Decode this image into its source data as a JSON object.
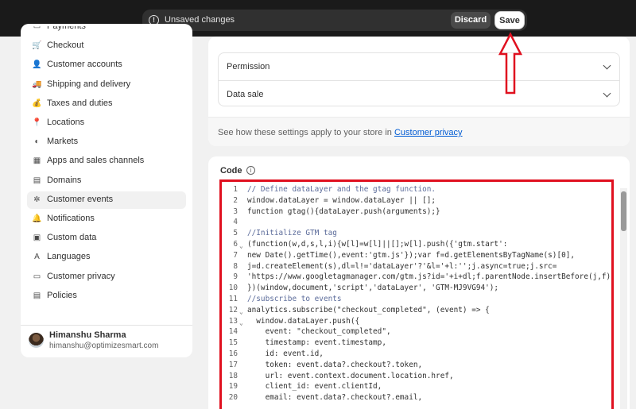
{
  "savebar": {
    "message": "Unsaved changes",
    "discard_label": "Discard",
    "save_label": "Save"
  },
  "sidebar": {
    "items": [
      {
        "label": "Payments",
        "icon": "payments-icon"
      },
      {
        "label": "Checkout",
        "icon": "cart-icon"
      },
      {
        "label": "Customer accounts",
        "icon": "person-icon"
      },
      {
        "label": "Shipping and delivery",
        "icon": "truck-icon"
      },
      {
        "label": "Taxes and duties",
        "icon": "tax-icon"
      },
      {
        "label": "Locations",
        "icon": "location-pin-icon"
      },
      {
        "label": "Markets",
        "icon": "globe-icon"
      },
      {
        "label": "Apps and sales channels",
        "icon": "apps-icon"
      },
      {
        "label": "Domains",
        "icon": "domains-icon"
      },
      {
        "label": "Customer events",
        "icon": "customer-events-icon",
        "active": true
      },
      {
        "label": "Notifications",
        "icon": "bell-icon"
      },
      {
        "label": "Custom data",
        "icon": "custom-data-icon"
      },
      {
        "label": "Languages",
        "icon": "languages-icon"
      },
      {
        "label": "Customer privacy",
        "icon": "privacy-icon"
      },
      {
        "label": "Policies",
        "icon": "policies-icon"
      }
    ],
    "user": {
      "name": "Himanshu Sharma",
      "email": "himanshu@optimizesmart.com"
    }
  },
  "settings": {
    "accordion": [
      "Permission",
      "Data sale"
    ],
    "privacy_note": "See how these settings apply to your store in ",
    "privacy_link": "Customer privacy"
  },
  "code_section": {
    "title": "Code",
    "lines": [
      {
        "n": "1",
        "fold": false,
        "text": "// Define dataLayer and the gtag function."
      },
      {
        "n": "2",
        "fold": false,
        "text": "window.dataLayer = window.dataLayer || [];"
      },
      {
        "n": "3",
        "fold": false,
        "text": "function gtag(){dataLayer.push(arguments);}"
      },
      {
        "n": "4",
        "fold": false,
        "text": ""
      },
      {
        "n": "5",
        "fold": false,
        "text": "//Initialize GTM tag"
      },
      {
        "n": "6",
        "fold": true,
        "text": "(function(w,d,s,l,i){w[l]=w[l]||[];w[l].push({'gtm.start':"
      },
      {
        "n": "7",
        "fold": false,
        "text": "new Date().getTime(),event:'gtm.js'});var f=d.getElementsByTagName(s)[0],"
      },
      {
        "n": "8",
        "fold": false,
        "text": "j=d.createElement(s),dl=l!='dataLayer'?'&l='+l:'';j.async=true;j.src="
      },
      {
        "n": "9",
        "fold": false,
        "text": "'https://www.googletagmanager.com/gtm.js?id='+i+dl;f.parentNode.insertBefore(j,f);"
      },
      {
        "n": "10",
        "fold": false,
        "text": "})(window,document,'script','dataLayer', 'GTM-MJ9VG94');"
      },
      {
        "n": "11",
        "fold": false,
        "text": "//subscribe to events"
      },
      {
        "n": "12",
        "fold": true,
        "text": "analytics.subscribe(\"checkout_completed\", (event) => {"
      },
      {
        "n": "13",
        "fold": true,
        "text": "  window.dataLayer.push({"
      },
      {
        "n": "14",
        "fold": false,
        "text": "    event: \"checkout_completed\","
      },
      {
        "n": "15",
        "fold": false,
        "text": "    timestamp: event.timestamp,"
      },
      {
        "n": "16",
        "fold": false,
        "text": "    id: event.id,"
      },
      {
        "n": "17",
        "fold": false,
        "text": "    token: event.data?.checkout?.token,"
      },
      {
        "n": "18",
        "fold": false,
        "text": "    url: event.context.document.location.href,"
      },
      {
        "n": "19",
        "fold": false,
        "text": "    client_id: event.clientId,"
      },
      {
        "n": "20",
        "fold": false,
        "text": "    email: event.data?.checkout?.email,"
      }
    ]
  }
}
